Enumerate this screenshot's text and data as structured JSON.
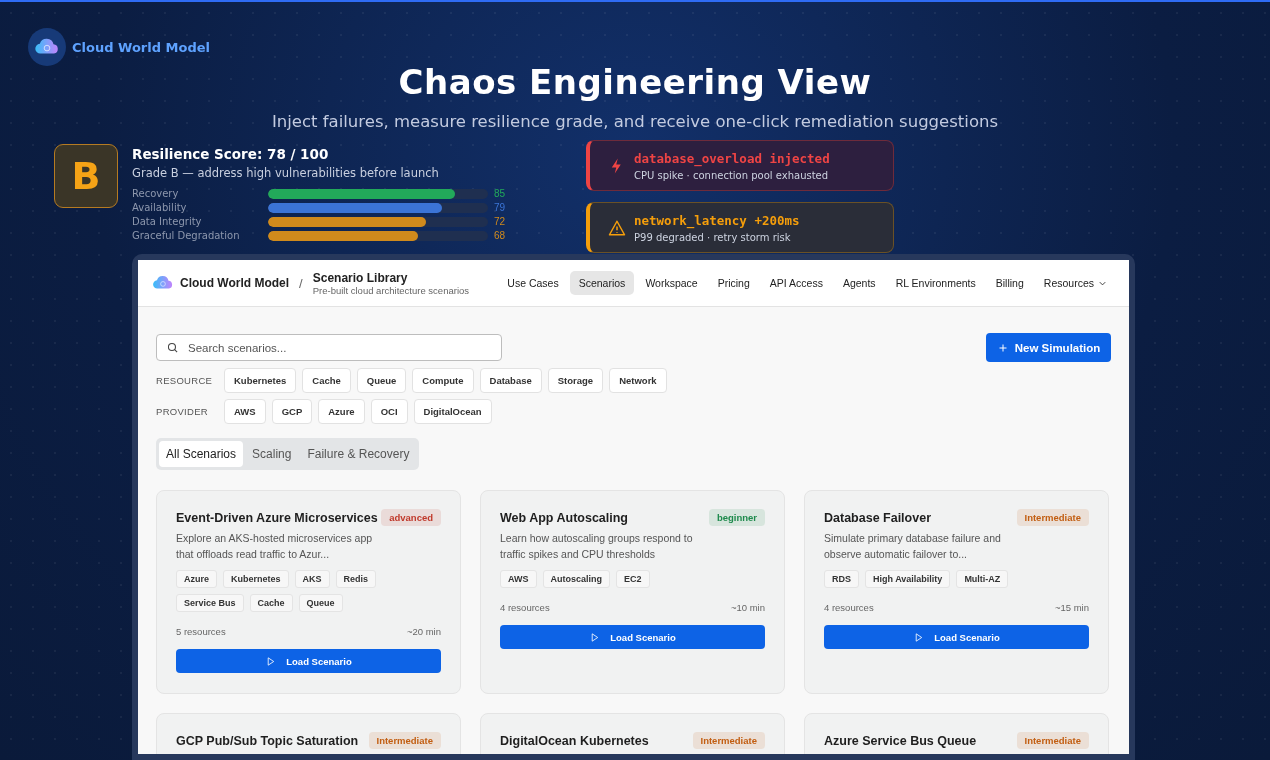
{
  "brand": {
    "name": "Cloud World Model"
  },
  "hero": {
    "title": "Chaos Engineering View",
    "subtitle": "Inject failures, measure resilience grade, and receive one-click remediation suggestions"
  },
  "resilience": {
    "grade": "B",
    "score": "Resilience Score: 78 / 100",
    "note": "Grade B — address high vulnerabilities before launch",
    "metrics": [
      {
        "label": "Recovery",
        "level": 0.85,
        "value": "85",
        "color": "#22a95a"
      },
      {
        "label": "Availability",
        "level": 0.79,
        "value": "79",
        "color": "#3b74d6"
      },
      {
        "label": "Data Integrity",
        "level": 0.72,
        "value": "72",
        "color": "#d08a1c"
      },
      {
        "label": "Graceful Degradation",
        "level": 0.68,
        "value": "68",
        "color": "#d08a1c"
      }
    ]
  },
  "alerts": [
    {
      "kind": "error",
      "title": "database_overload injected",
      "detail": "CPU spike · connection pool exhausted"
    },
    {
      "kind": "warning",
      "title": "network_latency +200ms",
      "detail": "P99 degraded · retry storm risk"
    }
  ],
  "app": {
    "brand": "Cloud World Model",
    "separator": "/",
    "page_title": "Scenario Library",
    "page_subtitle": "Pre-built cloud architecture scenarios",
    "nav": [
      {
        "label": "Use Cases",
        "selected": false
      },
      {
        "label": "Scenarios",
        "selected": true
      },
      {
        "label": "Workspace",
        "selected": false
      },
      {
        "label": "Pricing",
        "selected": false
      },
      {
        "label": "API Access",
        "selected": false
      },
      {
        "label": "Agents",
        "selected": false
      },
      {
        "label": "RL Environments",
        "selected": false
      },
      {
        "label": "Billing",
        "selected": false
      },
      {
        "label": "Resources",
        "selected": false,
        "dropdown": true
      }
    ],
    "search": {
      "placeholder": "Search scenarios..."
    },
    "new_button": "New Simulation",
    "filters": [
      {
        "label": "RESOURCE",
        "chips": [
          "Kubernetes",
          "Cache",
          "Queue",
          "Compute",
          "Database",
          "Storage",
          "Network"
        ]
      },
      {
        "label": "PROVIDER",
        "chips": [
          "AWS",
          "GCP",
          "Azure",
          "OCI",
          "DigitalOcean"
        ]
      }
    ],
    "tabs": [
      {
        "label": "All Scenarios",
        "selected": true
      },
      {
        "label": "Scaling",
        "selected": false
      },
      {
        "label": "Failure & Recovery",
        "selected": false
      }
    ],
    "cards": [
      {
        "title": "Event-Driven Azure Microservices",
        "badge": "advanced",
        "color": "#c0392b",
        "description": "Explore an AKS-hosted microservices app that offloads read traffic to Azur...",
        "tags": [
          "Azure",
          "Kubernetes",
          "AKS",
          "Redis",
          "Service Bus",
          "Cache",
          "Queue"
        ],
        "resources": "5 resources",
        "duration": "~20 min",
        "button": "Load Scenario"
      },
      {
        "title": "Web App Autoscaling",
        "badge": "beginner",
        "color": "#1e8a4c",
        "description": "Learn how autoscaling groups respond to traffic spikes and CPU thresholds",
        "tags": [
          "AWS",
          "Autoscaling",
          "EC2"
        ],
        "resources": "4 resources",
        "duration": "~10 min",
        "button": "Load Scenario"
      },
      {
        "title": "Database Failover",
        "badge": "Intermediate",
        "color": "#c25e12",
        "description": "Simulate primary database failure and observe automatic failover to...",
        "tags": [
          "RDS",
          "High Availability",
          "Multi-AZ"
        ],
        "resources": "4 resources",
        "duration": "~15 min",
        "button": "Load Scenario"
      },
      {
        "title": "GCP Pub/Sub Topic Saturation",
        "badge": "Intermediate",
        "color": "#c25e12"
      },
      {
        "title": "DigitalOcean Kubernetes",
        "badge": "Intermediate",
        "color": "#c25e12"
      },
      {
        "title": "Azure Service Bus Queue",
        "badge": "Intermediate",
        "color": "#c25e12"
      }
    ]
  }
}
